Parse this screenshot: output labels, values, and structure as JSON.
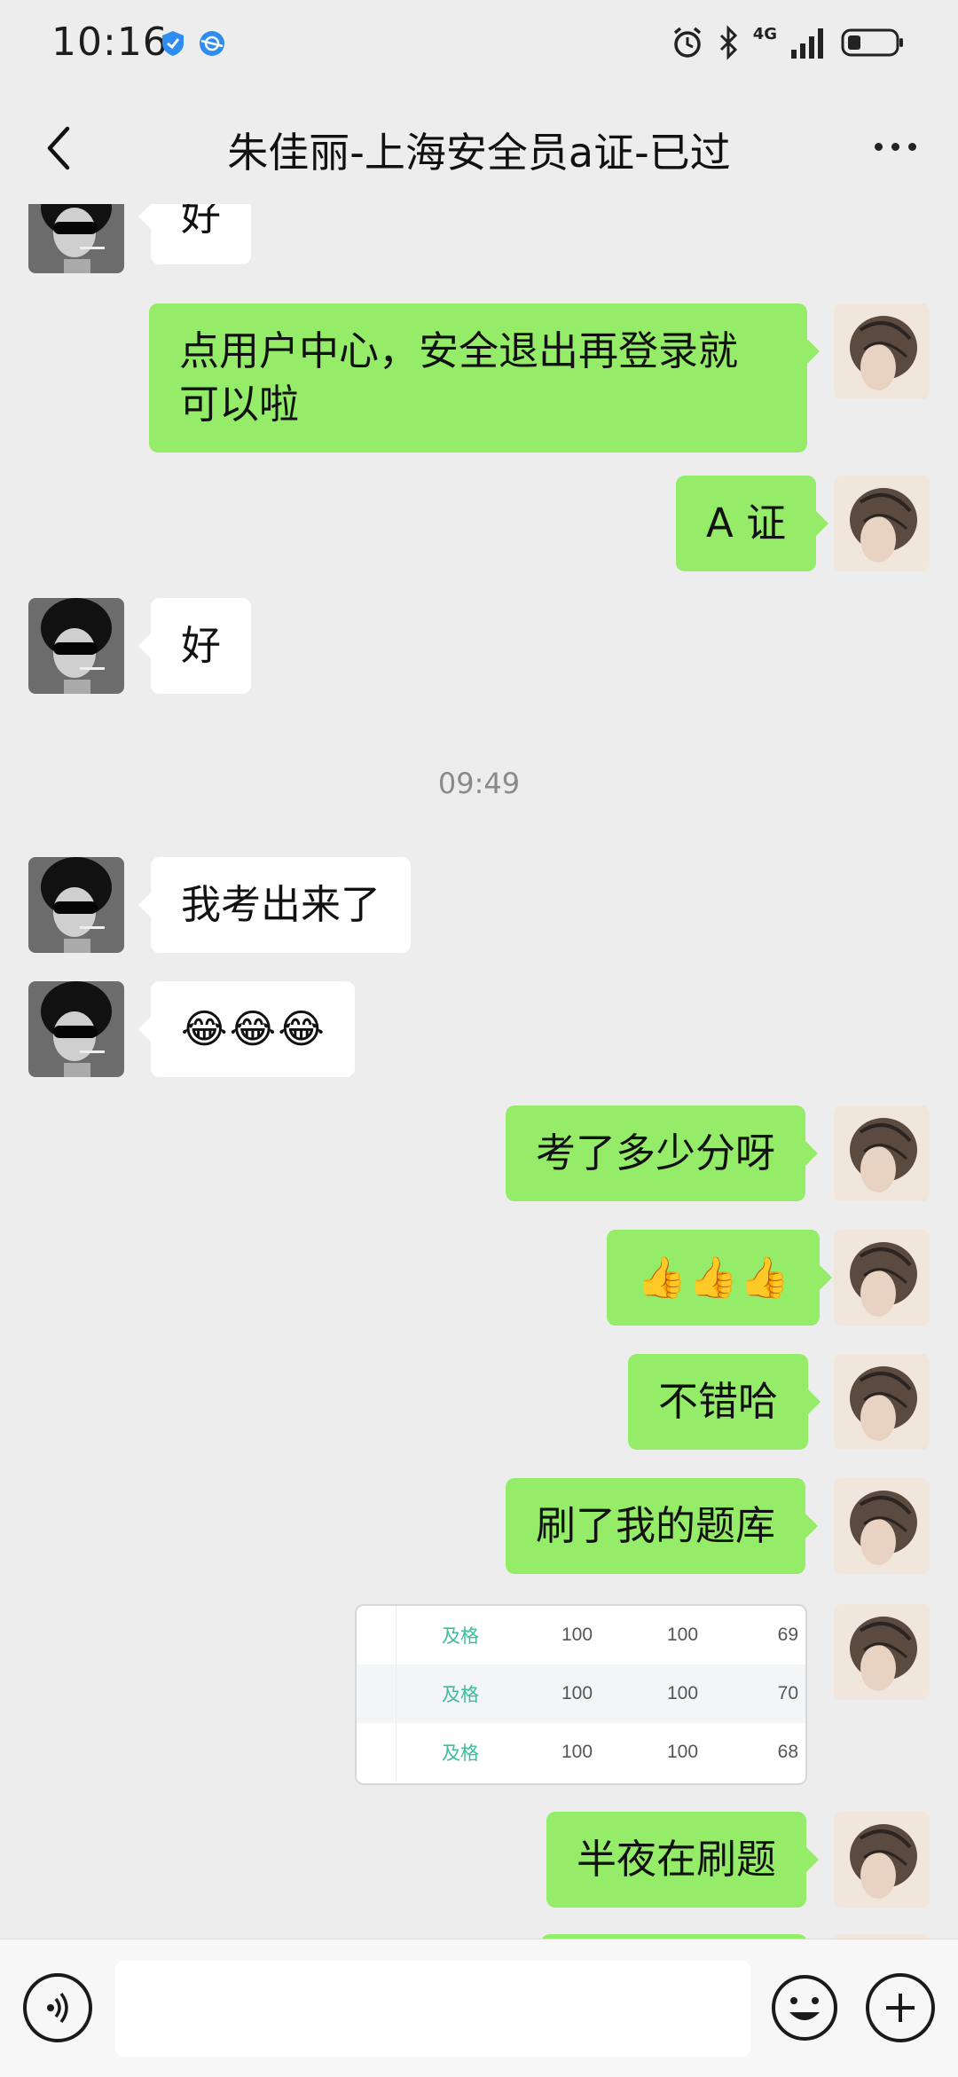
{
  "status_bar": {
    "time": "10:16",
    "network": "4G"
  },
  "header": {
    "title": "朱佳丽-上海安全员a证-已过"
  },
  "messages": [
    {
      "text": "好"
    },
    {
      "text": "点用户中心，安全退出再登录就可以啦"
    },
    {
      "text": "A 证"
    },
    {
      "text": "好"
    },
    {
      "text": "09:49"
    },
    {
      "text": "我考出来了"
    },
    {
      "emoji": [
        "😂",
        "😂",
        "😂"
      ]
    },
    {
      "text": "考了多少分呀"
    },
    {
      "emoji": [
        "👍",
        "👍",
        "👍"
      ]
    },
    {
      "text": "不错哈"
    },
    {
      "text": "刷了我的题库"
    },
    {
      "table": [
        [
          "及格",
          "100",
          "100",
          "69"
        ],
        [
          "及格",
          "100",
          "100",
          "70"
        ],
        [
          "及格",
          "100",
          "100",
          "68"
        ]
      ]
    },
    {
      "text": "半夜在刷题"
    }
  ],
  "colors": {
    "incoming_bubble": "#ffffff",
    "outgoing_bubble": "#95ec69",
    "background": "#ededed",
    "pass_text": "#3dbd9b"
  },
  "icons": {
    "back": "chevron-left-icon",
    "more": "more-dots-icon",
    "voice": "voice-icon",
    "emoji": "emoji-icon",
    "plus": "plus-icon"
  }
}
